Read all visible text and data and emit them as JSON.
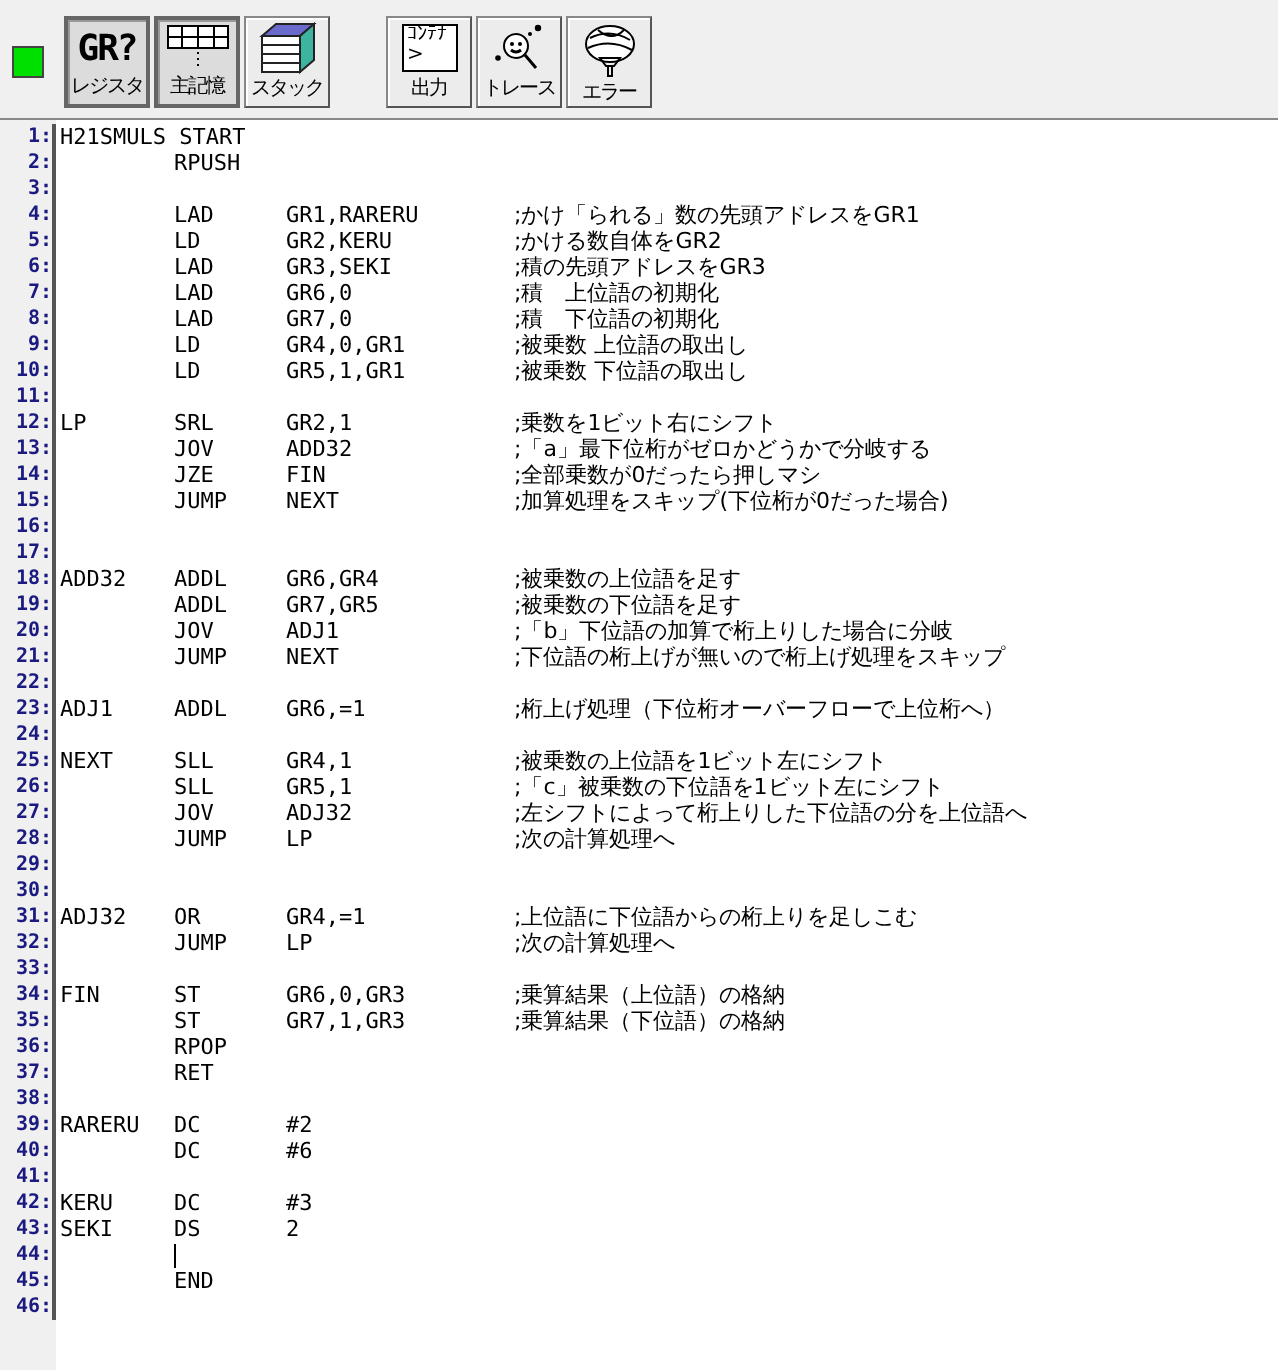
{
  "toolbar": {
    "groups": [
      [
        {
          "label": "レジスタ",
          "icon_text": [
            "GR?"
          ],
          "selected": true
        },
        {
          "label": "主記憶",
          "selected": true
        },
        {
          "label": "スタック",
          "selected": false
        }
      ],
      [
        {
          "label": "出力",
          "icon_text": [
            "ｺﾝﾃﾅ",
            ">"
          ],
          "selected": false
        },
        {
          "label": "トレース",
          "selected": false
        },
        {
          "label": "エラー",
          "selected": false
        }
      ]
    ]
  },
  "editor": {
    "lines": [
      {
        "number": "1:",
        "label": "H21SMULS START",
        "cursor": false
      },
      {
        "number": "2:",
        "op": "RPUSH",
        "cursor": false
      },
      {
        "number": "3:",
        "cursor": false
      },
      {
        "number": "4:",
        "op": "LAD",
        "operand": "GR1,RARERU",
        "comment": ";かけ「られる」数の先頭アドレスをGR1",
        "cursor": false
      },
      {
        "number": "5:",
        "op": "LD",
        "operand": "GR2,KERU",
        "comment": ";かける数自体をGR2",
        "cursor": false
      },
      {
        "number": "6:",
        "op": "LAD",
        "operand": "GR3,SEKI",
        "comment": ";積の先頭アドレスをGR3",
        "cursor": false
      },
      {
        "number": "7:",
        "op": "LAD",
        "operand": "GR6,0",
        "comment": ";積　上位語の初期化",
        "cursor": false
      },
      {
        "number": "8:",
        "op": "LAD",
        "operand": "GR7,0",
        "comment": ";積　下位語の初期化",
        "cursor": false
      },
      {
        "number": "9:",
        "op": "LD",
        "operand": "GR4,0,GR1",
        "comment": ";被乗数 上位語の取出し",
        "cursor": false
      },
      {
        "number": "10:",
        "op": "LD",
        "operand": "GR5,1,GR1",
        "comment": ";被乗数 下位語の取出し",
        "cursor": false
      },
      {
        "number": "11:",
        "cursor": false
      },
      {
        "number": "12:",
        "label": "LP",
        "op": "SRL",
        "operand": "GR2,1",
        "comment": ";乗数を1ビット右にシフト",
        "cursor": false
      },
      {
        "number": "13:",
        "op": "JOV",
        "operand": "ADD32",
        "comment": ";「a」最下位桁がゼロかどうかで分岐する",
        "cursor": false
      },
      {
        "number": "14:",
        "op": "JZE",
        "operand": "FIN",
        "comment": ";全部乗数が0だったら押しマシ",
        "cursor": false
      },
      {
        "number": "15:",
        "op": "JUMP",
        "operand": "NEXT",
        "comment": ";加算処理をスキップ(下位桁が0だった場合)",
        "cursor": false
      },
      {
        "number": "16:",
        "cursor": false
      },
      {
        "number": "17:",
        "cursor": false
      },
      {
        "number": "18:",
        "label": "ADD32",
        "op": "ADDL",
        "operand": "GR6,GR4",
        "comment": ";被乗数の上位語を足す",
        "cursor": false
      },
      {
        "number": "19:",
        "op": "ADDL",
        "operand": "GR7,GR5",
        "comment": ";被乗数の下位語を足す",
        "cursor": false
      },
      {
        "number": "20:",
        "op": "JOV",
        "operand": "ADJ1",
        "comment": ";「b」下位語の加算で桁上りした場合に分岐",
        "cursor": false
      },
      {
        "number": "21:",
        "op": "JUMP",
        "operand": "NEXT",
        "comment": ";下位語の桁上げが無いので桁上げ処理をスキップ",
        "cursor": false
      },
      {
        "number": "22:",
        "cursor": false
      },
      {
        "number": "23:",
        "label": "ADJ1",
        "op": "ADDL",
        "operand": "GR6,=1",
        "comment": ";桁上げ処理（下位桁オーバーフローで上位桁へ）",
        "cursor": false
      },
      {
        "number": "24:",
        "cursor": false
      },
      {
        "number": "25:",
        "label": "NEXT",
        "op": "SLL",
        "operand": "GR4,1",
        "comment": ";被乗数の上位語を1ビット左にシフト",
        "cursor": false
      },
      {
        "number": "26:",
        "op": "SLL",
        "operand": "GR5,1",
        "comment": ";「c」被乗数の下位語を1ビット左にシフト",
        "cursor": false
      },
      {
        "number": "27:",
        "op": "JOV",
        "operand": "ADJ32",
        "comment": ";左シフトによって桁上りした下位語の分を上位語へ",
        "cursor": false
      },
      {
        "number": "28:",
        "op": "JUMP",
        "operand": "LP",
        "comment": ";次の計算処理へ",
        "cursor": false
      },
      {
        "number": "29:",
        "cursor": false
      },
      {
        "number": "30:",
        "cursor": false
      },
      {
        "number": "31:",
        "label": "ADJ32",
        "op": "OR",
        "operand": "GR4,=1",
        "comment": ";上位語に下位語からの桁上りを足しこむ",
        "cursor": false
      },
      {
        "number": "32:",
        "op": "JUMP",
        "operand": "LP",
        "comment": ";次の計算処理へ",
        "cursor": false
      },
      {
        "number": "33:",
        "cursor": false
      },
      {
        "number": "34:",
        "label": "FIN",
        "op": "ST",
        "operand": "GR6,0,GR3",
        "comment": ";乗算結果（上位語）の格納",
        "cursor": false
      },
      {
        "number": "35:",
        "op": "ST",
        "operand": "GR7,1,GR3",
        "comment": ";乗算結果（下位語）の格納",
        "cursor": false
      },
      {
        "number": "36:",
        "op": "RPOP",
        "cursor": false
      },
      {
        "number": "37:",
        "op": "RET",
        "cursor": false
      },
      {
        "number": "38:",
        "cursor": false
      },
      {
        "number": "39:",
        "label": "RARERU",
        "op": "DC",
        "operand": "#2",
        "cursor": false
      },
      {
        "number": "40:",
        "op": "DC",
        "operand": "#6",
        "cursor": false
      },
      {
        "number": "41:",
        "cursor": false
      },
      {
        "number": "42:",
        "label": "KERU",
        "op": "DC",
        "operand": "#3",
        "cursor": false
      },
      {
        "number": "43:",
        "label": "SEKI",
        "op": "DS",
        "operand": "2",
        "cursor": false
      },
      {
        "number": "44:",
        "cursor": true
      },
      {
        "number": "45:",
        "op": "END",
        "cursor": false
      },
      {
        "number": "46:",
        "cursor": false
      }
    ]
  }
}
